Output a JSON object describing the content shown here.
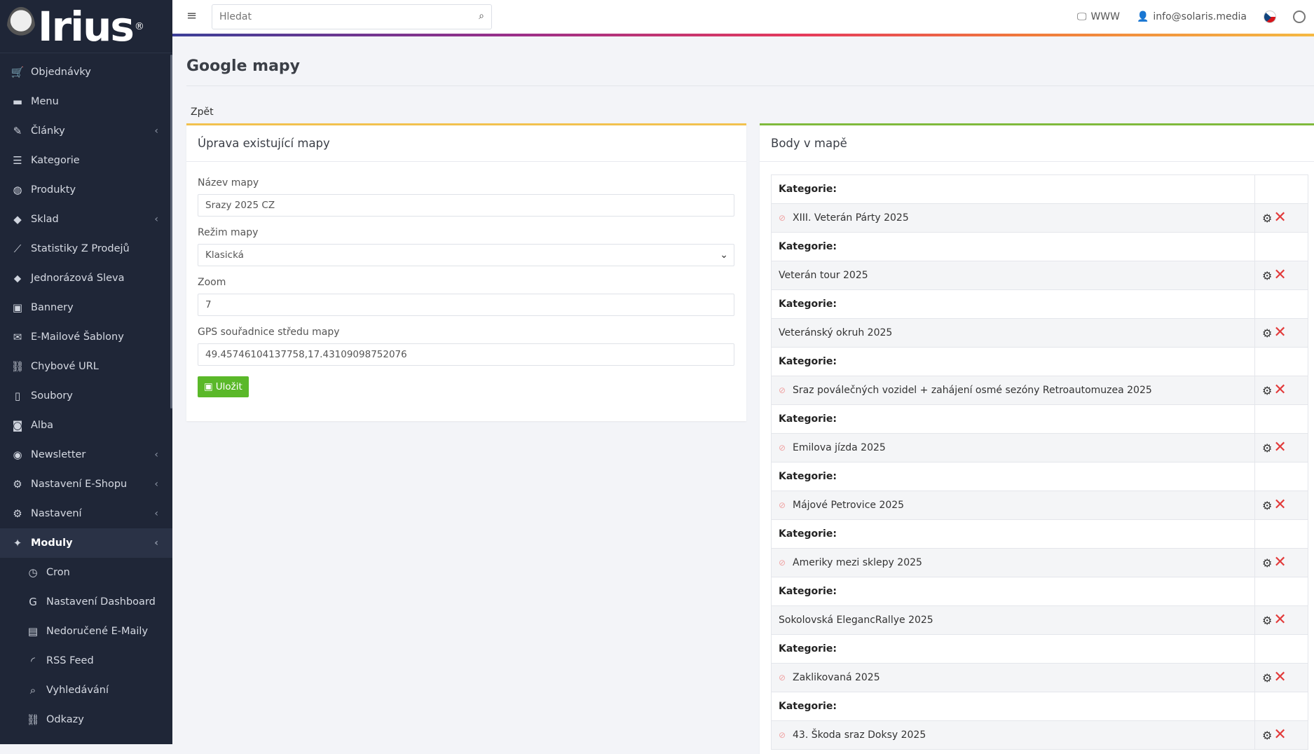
{
  "logo": {
    "text": "Irius",
    "reg": "®"
  },
  "sidebar": {
    "items": [
      {
        "label": "Objednávky",
        "icon": "cart-icon",
        "glyph": "🛒",
        "chevron": false
      },
      {
        "label": "Menu",
        "icon": "folder-icon",
        "glyph": "▬",
        "chevron": false
      },
      {
        "label": "Články",
        "icon": "pen-icon",
        "glyph": "✎",
        "chevron": true
      },
      {
        "label": "Kategorie",
        "icon": "list-icon",
        "glyph": "☰",
        "chevron": false
      },
      {
        "label": "Produkty",
        "icon": "basketball-icon",
        "glyph": "◍",
        "chevron": false
      },
      {
        "label": "Sklad",
        "icon": "boxes-icon",
        "glyph": "◆",
        "chevron": true
      },
      {
        "label": "Statistiky Z Prodejů",
        "icon": "chart-line-icon",
        "glyph": "⟋",
        "chevron": false
      },
      {
        "label": "Jednorázová Sleva",
        "icon": "tag-icon",
        "glyph": "⬥",
        "chevron": false
      },
      {
        "label": "Bannery",
        "icon": "image-icon",
        "glyph": "▣",
        "chevron": false
      },
      {
        "label": "E-Mailové Šablony",
        "icon": "envelope-icon",
        "glyph": "✉",
        "chevron": false
      },
      {
        "label": "Chybové URL",
        "icon": "link-icon",
        "glyph": "⛓",
        "chevron": false
      },
      {
        "label": "Soubory",
        "icon": "file-icon",
        "glyph": "▯",
        "chevron": false
      },
      {
        "label": "Alba",
        "icon": "camera-icon",
        "glyph": "◙",
        "chevron": false
      },
      {
        "label": "Newsletter",
        "icon": "mail-circle-icon",
        "glyph": "◉",
        "chevron": true
      },
      {
        "label": "Nastavení E-Shopu",
        "icon": "cogs-icon",
        "glyph": "⚙",
        "chevron": true
      },
      {
        "label": "Nastavení",
        "icon": "cogs-icon",
        "glyph": "⚙",
        "chevron": true
      },
      {
        "label": "Moduly",
        "icon": "puzzle-icon",
        "glyph": "✦",
        "chevron": true,
        "active": true
      }
    ],
    "subitems": [
      {
        "label": "Cron",
        "icon": "stopwatch-icon",
        "glyph": "◷"
      },
      {
        "label": "Nastavení Dashboard",
        "icon": "google-icon",
        "glyph": "G"
      },
      {
        "label": "Nedoručené E-Maily",
        "icon": "mail-bulk-icon",
        "glyph": "▤"
      },
      {
        "label": "RSS Feed",
        "icon": "rss-icon",
        "glyph": "◜"
      },
      {
        "label": "Vyhledávání",
        "icon": "search-icon",
        "glyph": "⌕"
      },
      {
        "label": "Odkazy",
        "icon": "link-icon",
        "glyph": "⛓"
      }
    ]
  },
  "topbar": {
    "search_placeholder": "Hledat",
    "www_label": "WWW",
    "user_email": "info@solaris.media"
  },
  "page": {
    "title": "Google mapy",
    "back_label": "Zpět"
  },
  "edit_card": {
    "title": "Úprava existující mapy",
    "name_label": "Název mapy",
    "name_value": "Srazy 2025 CZ",
    "mode_label": "Režim mapy",
    "mode_value": "Klasická",
    "zoom_label": "Zoom",
    "zoom_value": "7",
    "gps_label": "GPS souřadnice středu mapy",
    "gps_value": "49.45746104137758,17.43109098752076",
    "save_label": "Uložit"
  },
  "points_card": {
    "title": "Body v mapě",
    "category_label": "Kategorie:",
    "points": [
      {
        "name": "XIII. Veterán Párty 2025",
        "hidden": true
      },
      {
        "name": "Veterán tour 2025",
        "hidden": false
      },
      {
        "name": "Veteránský okruh 2025",
        "hidden": false
      },
      {
        "name": "Sraz poválečných vozidel + zahájení osmé sezóny Retroautomuzea 2025",
        "hidden": true
      },
      {
        "name": "Emilova jízda 2025",
        "hidden": true
      },
      {
        "name": "Májové Petrovice 2025",
        "hidden": true
      },
      {
        "name": "Ameriky mezi sklepy 2025",
        "hidden": true
      },
      {
        "name": "Sokolovská ElegancRallye 2025",
        "hidden": false
      },
      {
        "name": "Zaklikovaná 2025",
        "hidden": true
      },
      {
        "name": "43. Škoda sraz Doksy 2025",
        "hidden": true
      }
    ]
  }
}
